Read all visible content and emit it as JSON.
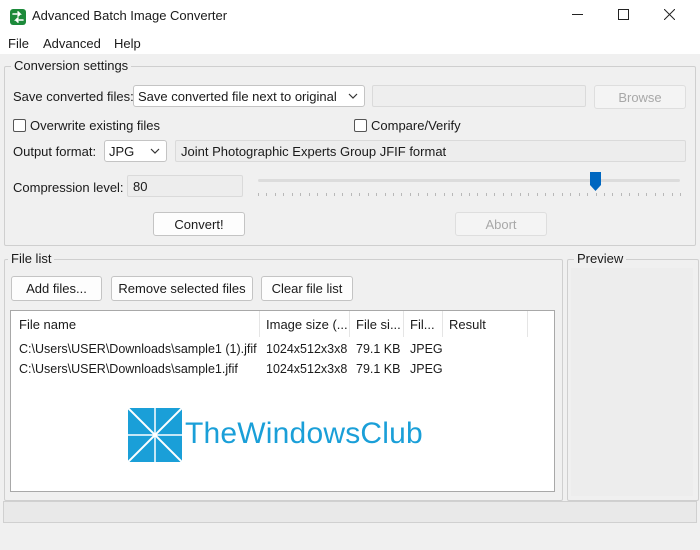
{
  "window": {
    "title": "Advanced Batch Image Converter"
  },
  "menu": [
    "File",
    "Advanced",
    "Help"
  ],
  "conversion": {
    "group_label": "Conversion settings",
    "save_label": "Save converted files:",
    "save_option": "Save converted file next to original",
    "browse_label": "Browse",
    "overwrite_label": "Overwrite existing files",
    "compare_label": "Compare/Verify",
    "format_label": "Output format:",
    "format_value": "JPG",
    "format_desc": "Joint Photographic Experts Group JFIF format",
    "compression_label": "Compression level:",
    "compression_value": "80",
    "compression_level_fraction": 0.8,
    "convert_label": "Convert!",
    "abort_label": "Abort"
  },
  "file_list": {
    "group_label": "File list",
    "add_label": "Add files...",
    "remove_label": "Remove selected files",
    "clear_label": "Clear file list",
    "columns": [
      "File name",
      "Image size (...",
      "File si...",
      "Fil...",
      "Result"
    ],
    "rows": [
      [
        "C:\\Users\\USER\\Downloads\\sample1 (1).jfif",
        "1024x512x3x8",
        "79.1 KB",
        "JPEG",
        ""
      ],
      [
        "C:\\Users\\USER\\Downloads\\sample1.jfif",
        "1024x512x3x8",
        "79.1 KB",
        "JPEG",
        ""
      ]
    ]
  },
  "preview": {
    "group_label": "Preview"
  },
  "watermark": {
    "text": "TheWindowsClub",
    "color": "#1a9fd8"
  },
  "colors": {
    "accent": "#0067c0"
  }
}
